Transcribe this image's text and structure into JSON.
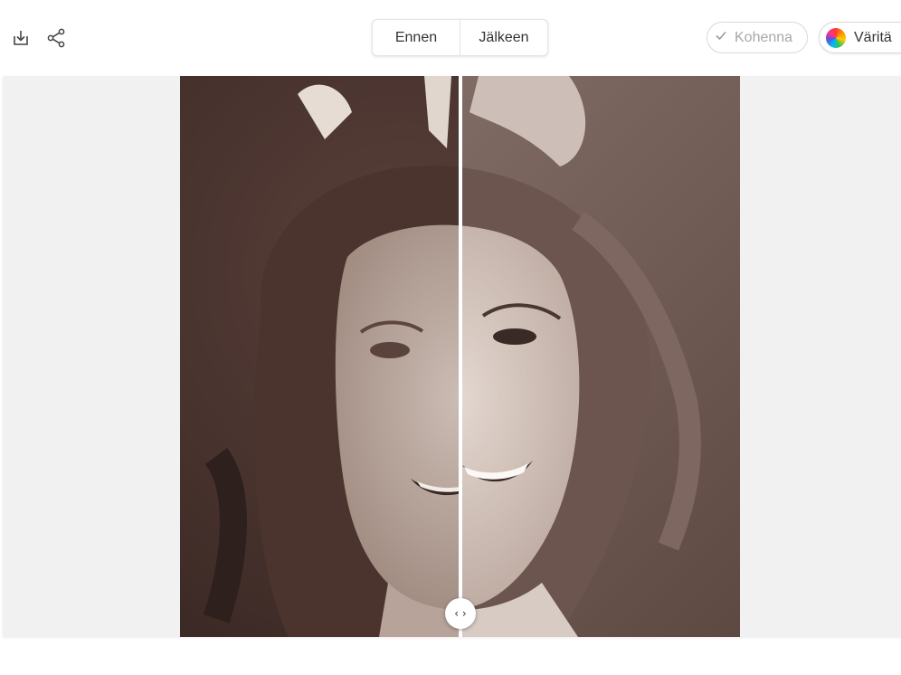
{
  "toolbar": {
    "download_icon": "download-icon",
    "share_icon": "share-icon",
    "view_toggle": {
      "before_label": "Ennen",
      "after_label": "Jälkeen"
    },
    "enhance": {
      "label": "Kohenna",
      "icon": "check-icon",
      "state": "applied"
    },
    "colorize": {
      "label": "Väritä",
      "icon": "color-wheel-icon"
    }
  },
  "comparison": {
    "handle_glyph": "‹ ›",
    "handle_icon": "chevrons-left-right-icon"
  },
  "colors": {
    "stage_background": "#f1f1f1",
    "before_tone": "#4a3530",
    "after_tone": "#7a6660",
    "divider": "#ffffff"
  }
}
